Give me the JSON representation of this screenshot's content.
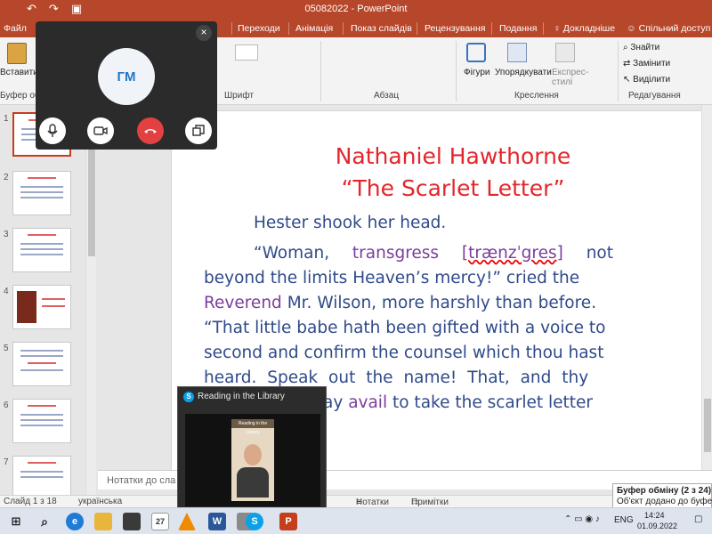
{
  "titlebar": {
    "title": "05082022 - PowerPoint"
  },
  "tabs": {
    "file": "Файл",
    "transitions": "Переходи",
    "animations": "Анімація",
    "slideshow": "Показ слайдів",
    "review": "Рецензування",
    "view": "Подання",
    "tell_me": "Докладніше",
    "share": "Спільний доступ"
  },
  "ribbon": {
    "paste": "Вставити",
    "clipboard": "Буфер обмі",
    "font": "Шрифт",
    "paragraph": "Абзац",
    "shapes": "Фігури",
    "arrange": "Упорядкувати",
    "quick_styles": "Експрес-стилі",
    "drawing": "Креслення",
    "find": "Знайти",
    "replace": "Замінити",
    "select": "Виділити",
    "editing": "Редагування"
  },
  "call": {
    "initials": "ГМ",
    "close": "×"
  },
  "slide": {
    "title_line1": "Nathaniel Hawthorne",
    "title_line2": "“The Scarlet Letter”",
    "line1": "Hester shook her head.",
    "l2a": "“Woman,",
    "l2b": "transgress",
    "l2c": "[trænzˈgres]",
    "l2d": "not",
    "l3": "beyond the limits Heaven’s mercy!” cried the",
    "l4a": "Reverend",
    "l4b": "Mr. Wilson, more harshly than before.",
    "l5": "“That little babe hath been gifted with a voice to",
    "l6": "second and confirm the counsel which thou hast",
    "l7": "heard. Speak out the name! That, and thy",
    "l8a": "ay",
    "l8b": "avail",
    "l8c": "to take the scarlet letter"
  },
  "notes": {
    "placeholder": "Нотатки до сла"
  },
  "statusbar": {
    "slide_count": "Слайд 1 з 18",
    "language": "українська",
    "notes": "Нотатки",
    "comments": "Примітки"
  },
  "reader": {
    "title": "Reading in the Library",
    "inner_title": "Reading in the Library"
  },
  "toast": {
    "line1": "Буфер обміну (2 з 24)",
    "line2": "Об'єкт додано до буфера."
  },
  "tray": {
    "lang": "ENG",
    "time": "14:24",
    "date": "01.09.2022"
  },
  "colors": {
    "accent": "#b7472a",
    "title_red": "#e3262b",
    "body_blue": "#2f4a8a",
    "purple": "#7c3d9b"
  }
}
